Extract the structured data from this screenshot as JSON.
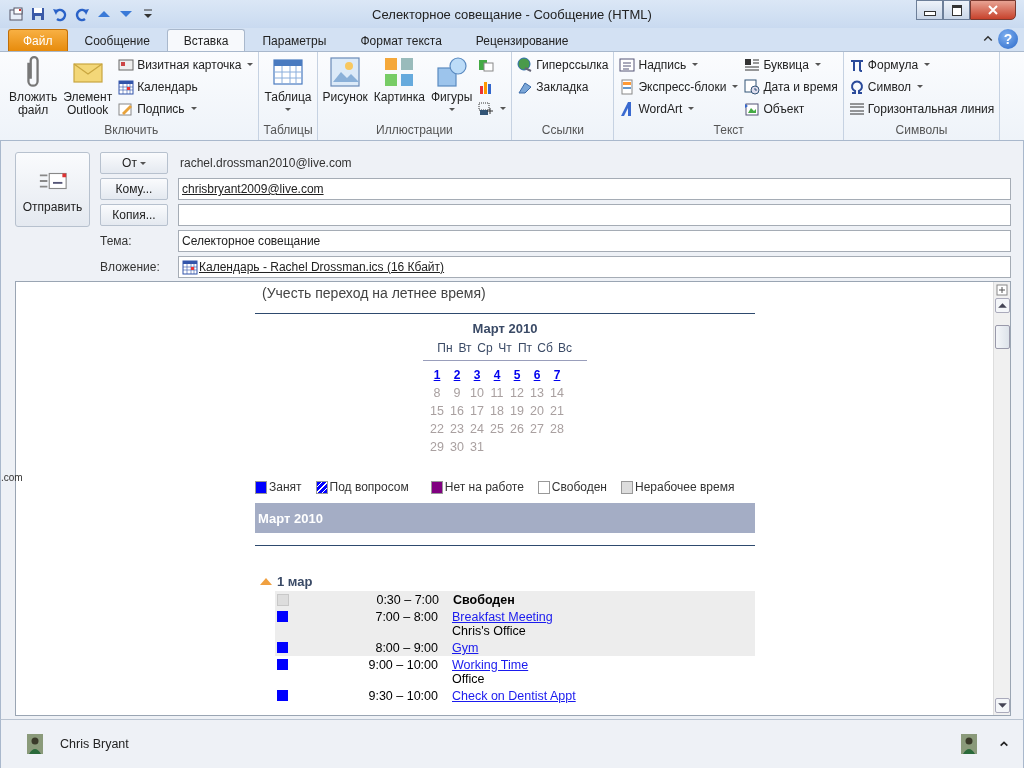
{
  "window": {
    "title": "Селекторное совещание - Сообщение (HTML)"
  },
  "tabs": [
    {
      "label": "Файл",
      "kind": "file",
      "selected": false
    },
    {
      "label": "Сообщение",
      "kind": "tab",
      "selected": false
    },
    {
      "label": "Вставка",
      "kind": "tab",
      "selected": true
    },
    {
      "label": "Параметры",
      "kind": "tab",
      "selected": false
    },
    {
      "label": "Формат текста",
      "kind": "tab",
      "selected": false
    },
    {
      "label": "Рецензирование",
      "kind": "tab",
      "selected": false
    }
  ],
  "help": "?",
  "ribbon": [
    {
      "label": "Включить",
      "items": [
        {
          "kind": "large",
          "lines": [
            "Вложить",
            "файл"
          ],
          "dropdown": false
        },
        {
          "kind": "large",
          "lines": [
            "Элемент",
            "Outlook"
          ],
          "dropdown": false
        },
        {
          "kind": "small",
          "label": "Визитная карточка",
          "dropdown": true
        },
        {
          "kind": "small",
          "label": "Календарь",
          "dropdown": false
        },
        {
          "kind": "small",
          "label": "Подпись",
          "dropdown": true
        }
      ]
    },
    {
      "label": "Таблицы",
      "items": [
        {
          "kind": "large",
          "lines": [
            "Таблица"
          ],
          "dropdown": true
        }
      ]
    },
    {
      "label": "Иллюстрации",
      "items": [
        {
          "kind": "large",
          "lines": [
            "Рисунок"
          ],
          "dropdown": false
        },
        {
          "kind": "large",
          "lines": [
            "Картинка"
          ],
          "dropdown": false
        },
        {
          "kind": "large",
          "lines": [
            "Фигуры"
          ],
          "dropdown": true
        },
        {
          "kind": "small",
          "dropdown": false
        },
        {
          "kind": "small",
          "dropdown": false
        },
        {
          "kind": "small",
          "dropdown": true
        }
      ]
    },
    {
      "label": "Ссылки",
      "items": [
        {
          "kind": "small",
          "label": "Гиперссылка",
          "dropdown": false
        },
        {
          "kind": "small",
          "label": "Закладка",
          "dropdown": false
        }
      ]
    },
    {
      "label": "Текст",
      "items": [
        {
          "kind": "small",
          "label": "Надпись",
          "dropdown": true
        },
        {
          "kind": "small",
          "label": "Экспресс-блоки",
          "dropdown": true
        },
        {
          "kind": "small",
          "label": "WordArt",
          "dropdown": true
        },
        {
          "kind": "small",
          "label": "Буквица",
          "dropdown": true
        },
        {
          "kind": "small",
          "label": "Дата и время",
          "dropdown": false
        },
        {
          "kind": "small",
          "label": "Объект",
          "dropdown": false
        }
      ]
    },
    {
      "label": "Символы",
      "items": [
        {
          "kind": "small",
          "label": "Формула",
          "dropdown": true
        },
        {
          "kind": "small",
          "label": "Символ",
          "dropdown": true
        },
        {
          "kind": "small",
          "label": "Горизонтальная линия",
          "dropdown": false
        }
      ]
    }
  ],
  "send": {
    "label": "Отправить"
  },
  "fields": [
    {
      "kind": "from",
      "button": "От",
      "dropdown": true,
      "value": "rachel.drossman2010@live.com"
    },
    {
      "kind": "recipient",
      "button": "Кому...",
      "dropdown": false,
      "value": "chrisbryant2009@live.com",
      "link": true
    },
    {
      "kind": "recipient",
      "button": "Копия...",
      "dropdown": false
    },
    {
      "kind": "subject",
      "label": "Тема:",
      "value": "Селекторное совещание",
      "link": false
    },
    {
      "kind": "attachment",
      "label": "Вложение:",
      "value": "Календарь - Rachel Drossman.ics (16 Кбайт)",
      "link": true
    }
  ],
  "body": {
    "note": "(Учесть переход на летнее время)",
    "calendar": {
      "title": "Март 2010",
      "weekdays": [
        "Пн",
        "Вт",
        "Ср",
        "Чт",
        "Пт",
        "Сб",
        "Вс"
      ],
      "weeks": [
        [
          {
            "day": "1",
            "link": true
          },
          {
            "day": "2",
            "link": true
          },
          {
            "day": "3",
            "link": true
          },
          {
            "day": "4",
            "link": true
          },
          {
            "day": "5",
            "link": true
          },
          {
            "day": "6",
            "link": true
          },
          {
            "day": "7",
            "link": true
          }
        ],
        [
          {
            "day": "8",
            "link": false
          },
          {
            "day": "9",
            "link": false
          },
          {
            "day": "10",
            "link": false
          },
          {
            "day": "11",
            "link": false
          },
          {
            "day": "12",
            "link": false
          },
          {
            "day": "13",
            "link": false
          },
          {
            "day": "14",
            "link": false
          }
        ],
        [
          {
            "day": "15",
            "link": false
          },
          {
            "day": "16",
            "link": false
          },
          {
            "day": "17",
            "link": false
          },
          {
            "day": "18",
            "link": false
          },
          {
            "day": "19",
            "link": false
          },
          {
            "day": "20",
            "link": false
          },
          {
            "day": "21",
            "link": false
          }
        ],
        [
          {
            "day": "22",
            "link": false
          },
          {
            "day": "23",
            "link": false
          },
          {
            "day": "24",
            "link": false
          },
          {
            "day": "25",
            "link": false
          },
          {
            "day": "26",
            "link": false
          },
          {
            "day": "27",
            "link": false
          },
          {
            "day": "28",
            "link": false
          }
        ],
        [
          {
            "day": "29",
            "link": false
          },
          {
            "day": "30",
            "link": false
          },
          {
            "day": "31",
            "link": false
          }
        ]
      ]
    },
    "legend": [
      {
        "label": "Занят",
        "color": "#0000ff",
        "kind": "solid"
      },
      {
        "label": "Под вопросом",
        "color": "#0000ff",
        "kind": "striped"
      },
      {
        "label": "Нет на работе",
        "color": "#800080",
        "kind": "solid"
      },
      {
        "label": "Свободен",
        "color": "#ffffff",
        "kind": "solid"
      },
      {
        "label": "Нерабочее время",
        "color": "#dddddd",
        "kind": "solid"
      }
    ],
    "month_band": "Март 2010",
    "day": {
      "label": "1 мар",
      "expanded": true
    },
    "events": [
      {
        "time": "0:30 – 7:00",
        "title": "Свободен",
        "kind": "free",
        "color": "#dddddd",
        "shaded": true
      },
      {
        "time": "7:00 – 8:00",
        "title": "Breakfast Meeting",
        "location": "Chris's Office",
        "kind": "busy",
        "color": "#0000ff",
        "shaded": true
      },
      {
        "time": "8:00 – 9:00",
        "title": "Gym",
        "kind": "busy",
        "color": "#0000ff",
        "shaded": true
      },
      {
        "time": "9:00 – 10:00",
        "title": "Working Time",
        "location": "Office",
        "kind": "busy",
        "color": "#0000ff",
        "shaded": false
      },
      {
        "time": "9:30 – 10:00",
        "title": "Check on Dentist Appt",
        "kind": "busy",
        "color": "#0000ff",
        "shaded": false
      }
    ]
  },
  "edge_text": ".com",
  "people": {
    "name": "Chris Bryant"
  }
}
